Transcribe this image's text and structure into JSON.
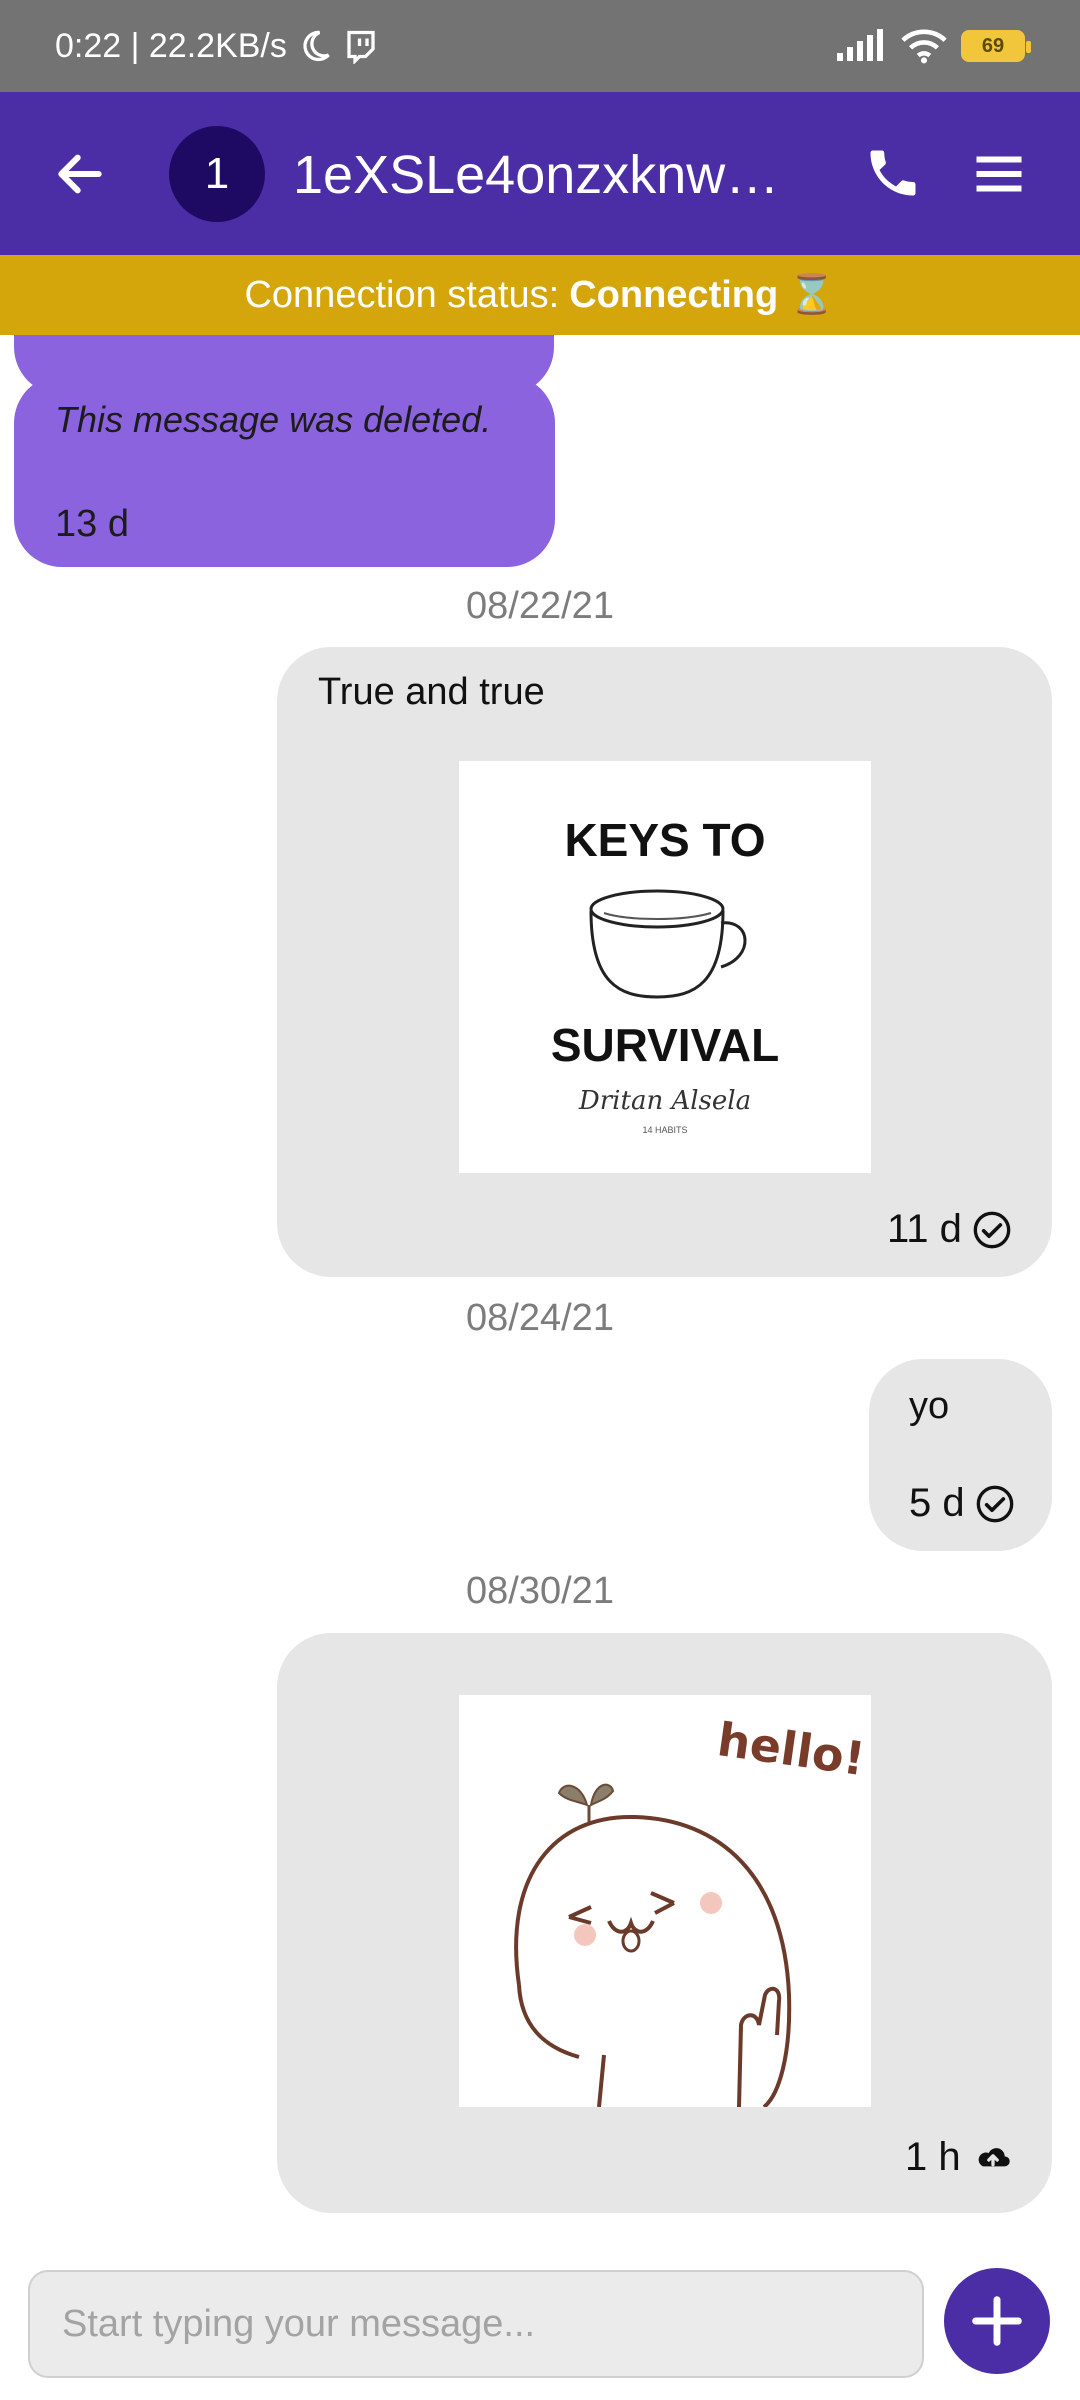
{
  "status_bar": {
    "time_speed": "0:22 | 22.2KB/s",
    "battery": "69",
    "icons": [
      "moon-icon",
      "twitch-icon",
      "signal-icon",
      "wifi-icon",
      "battery-icon"
    ]
  },
  "header": {
    "back_icon": "arrow-left-icon",
    "avatar_text": "1",
    "title": "1eXSLe4onzxknwN…",
    "call_icon": "phone-icon",
    "menu_icon": "hamburger-menu-icon",
    "background": "#4b2ea6"
  },
  "connection": {
    "label": "Connection status:",
    "status": "Connecting",
    "icon": "⌛",
    "background": "#d5a60c"
  },
  "messages": {
    "deleted": {
      "text": "This message was deleted.",
      "time": "13 d"
    },
    "date1": "08/22/21",
    "msg1": {
      "text": "True and true",
      "sticker_title_top": "KEYS TO",
      "sticker_title_bottom": "SURVIVAL",
      "sticker_signature": "Dritan Alsela",
      "sticker_small": "14 HABITS",
      "time": "11 d",
      "status_icon": "check-circle-icon"
    },
    "date2": "08/24/21",
    "msg2": {
      "text": "yo",
      "time": "5 d",
      "status_icon": "check-circle-icon"
    },
    "date3": "08/30/21",
    "msg3": {
      "sticker_text": "hello!",
      "time": "1 h",
      "status_icon": "cloud-upload-icon"
    }
  },
  "composer": {
    "placeholder": "Start typing your message...",
    "add_icon": "plus-icon"
  },
  "colors": {
    "incoming_bubble": "#8c63df",
    "outgoing_bubble": "#e6e6e6",
    "accent": "#4b2ea6"
  }
}
